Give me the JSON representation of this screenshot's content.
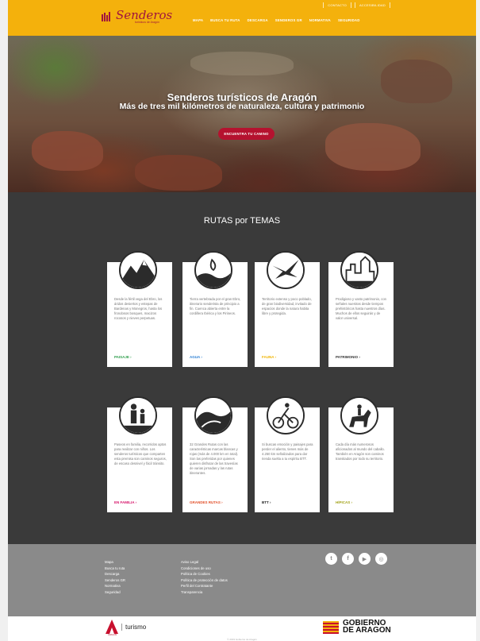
{
  "header": {
    "topbar": [
      "CONTACTO",
      "ACCESIBILIDAD"
    ],
    "logo_text": "Senderos",
    "logo_subtitle": "turísticos de Aragón",
    "nav": [
      "MAPA",
      "BUSCA TU RUTA",
      "DESCARGA",
      "SENDEROS GR",
      "NORMATIVA",
      "SEGURIDAD"
    ]
  },
  "hero": {
    "title": "Senderos turísticos de Aragón",
    "subtitle": "Más de tres mil kilómetros de naturaleza, cultura y patrimonio",
    "button": "ENCUENTRA TU CAMINO"
  },
  "routes": {
    "title": "RUTAS por TEMAS",
    "cards": [
      {
        "icon": "mountain-landscape-icon",
        "text": "Desde la fértil vega del Ebro, los áridos desiertos y estepas de Bardenas y Monegros, hasta los frondosos bosques, macizos rocosos y nieves perpetuas.",
        "link": "PAISAJE ›",
        "color": "#2e9e4b"
      },
      {
        "icon": "water-drop-icon",
        "text": "Tierra vertebrada por el gran Ebro, itinerario senderista de principio a fin. Cuenca abierta entre la cordillera Ibérica y los Pirineos.",
        "link": "AGUA ›",
        "color": "#2b7fd4"
      },
      {
        "icon": "bird-icon",
        "text": "Territorio extenso y poco poblado, de gran biodiversidad, invitado de espacios donde la natura habita libre y protegida.",
        "link": "FAUNA ›",
        "color": "#f0b400"
      },
      {
        "icon": "castle-heritage-icon",
        "text": "Prodigioso y vasto patrimonio, con señales nuestras desde tiempos prehistóricos hasta nuestros días. Muchos de ellos seguirás y de valor universal.",
        "link": "PATRIMONIO ›",
        "color": "#333333"
      },
      {
        "icon": "family-hikers-icon",
        "text": "Paseos en familia, recorridos aptos para realizar con niños. Los senderos turísticos que comparten esta premisa son caminos seguros, de escaso desnivel y fácil tránsito.",
        "link": "EN FAMILIA ›",
        "color": "#d6146a"
      },
      {
        "icon": "long-trail-icon",
        "text": "32 Grandes Rutas con las características marcas blancas y rojas (más de 4.000 km en total). Son las preferidas por quienes quieren disfrutar de las travesías de varias jornadas y las rutas itinerantes.",
        "link": "GRANDES RUTAS ›",
        "color": "#e2502a"
      },
      {
        "icon": "mountain-bike-icon",
        "text": "Si buscas emoción y paisajes para perder el aliento, tienes más de 4.250 km señalizados para dar rienda suelta a tu espíritu BTT.",
        "link": "BTT ›",
        "color": "#222222"
      },
      {
        "icon": "horse-rider-icon",
        "text": "Cada día más numerosos aficionados al mundo del caballo. También en Aragón son caminos transitados por todo su territorio.",
        "link": "HÍPICAS ›",
        "color": "#a3a31b"
      }
    ]
  },
  "footer": {
    "col1": [
      "Mapa",
      "Busca tu ruta",
      "Descarga",
      "Senderos GR",
      "Normativa",
      "Seguridad"
    ],
    "col2": [
      "Aviso Legal",
      "Condiciones de uso",
      "Política de Cookies",
      "Política de protección de datos",
      "Perfil del Contratante",
      "Transparencia"
    ],
    "social": [
      {
        "icon": "twitter-icon",
        "glyph": "t"
      },
      {
        "icon": "facebook-icon",
        "glyph": "f"
      },
      {
        "icon": "youtube-icon",
        "glyph": "▶"
      },
      {
        "icon": "instagram-icon",
        "glyph": "◎"
      }
    ]
  },
  "bottom": {
    "turismo_label": "turismo",
    "aragon_small": "ARAGÓN",
    "gobierno_line1": "GOBIERNO",
    "gobierno_line2": "DE ARAGON",
    "copyright": "© 2019 Gobierno de Aragón"
  }
}
